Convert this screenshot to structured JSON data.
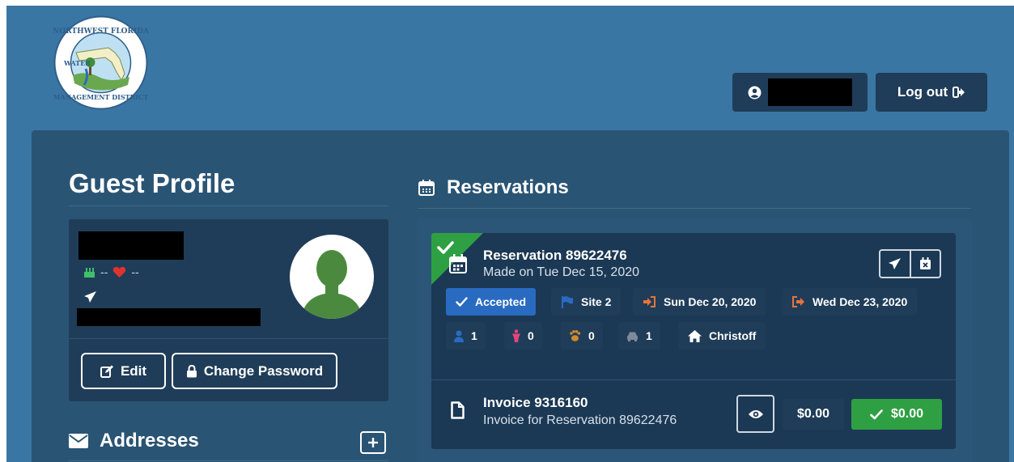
{
  "header": {
    "logo": {
      "name": "northwest-florida-water-management-district-seal",
      "text": "NORTHWEST FLORIDA WATER MANAGEMENT DISTRICT"
    },
    "user_icon": "user-circle-icon",
    "logout_label": "Log out",
    "logout_icon": "sign-out-icon"
  },
  "profile": {
    "title": "Guest Profile",
    "birthday_value": "--",
    "love_value": "--",
    "edit_label": "Edit",
    "change_password_label": "Change Password"
  },
  "addresses": {
    "title": "Addresses"
  },
  "reservations": {
    "title": "Reservations",
    "item": {
      "title": "Reservation 89622476",
      "made_on": "Made on Tue Dec 15, 2020",
      "status": "Accepted",
      "site": "Site 2",
      "check_in": "Sun Dec 20, 2020",
      "check_out": "Wed Dec 23, 2020",
      "adults": "1",
      "children": "0",
      "pets": "0",
      "vehicles": "1",
      "lodging": "Christoff"
    },
    "invoice": {
      "title": "Invoice 9316160",
      "subtitle": "Invoice for Reservation 89622476",
      "amount_due": "$0.00",
      "amount_paid": "$0.00"
    }
  },
  "colors": {
    "page_bg": "#3a76a4",
    "panel_bg": "#2a5474",
    "card_bg": "#1f3d59",
    "accent_blue": "#2a6bc2",
    "success_green": "#2ea043",
    "heart_red": "#e0322e",
    "arrow_orange": "#e8743b",
    "cake_green": "#3fbf6a",
    "child_pink": "#e2457a",
    "paw_orange": "#d08a2c"
  }
}
